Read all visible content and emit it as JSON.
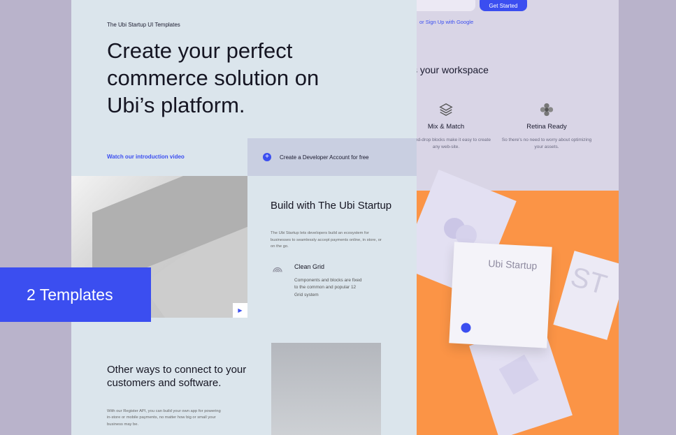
{
  "back_page": {
    "get_started": "Get Started",
    "google_signup": "or Sign Up with Google",
    "workspace_heading": "s your workspace",
    "features": [
      {
        "icon": "layers-icon",
        "title": "Mix & Match",
        "desc": "Drag-and-drop blocks make it easy to create any web-site."
      },
      {
        "icon": "flower-icon",
        "title": "Retina Ready",
        "desc": "So there's no need to worry about optimizing your assets."
      }
    ],
    "card_text": "Ubi Startup",
    "card_mark": "ST"
  },
  "front_page": {
    "eyebrow": "The Ubi Startup UI Templates",
    "hero": "Create your perfect commerce solution on Ubi’s platform.",
    "watch_link": "Watch our introduction video",
    "dev_account": "Create a Developer Account for free",
    "build_title": "Build with The Ubi Startup",
    "build_desc": "The Ubi Startup lets developers build an ecosystem for businesses to seamlessly accept payments online, in store, or on the go.",
    "grid_title": "Clean Grid",
    "grid_desc": "Components and blocks are fixed to the common and popular 12 Grid system",
    "other_title": "Other ways to connect to your customers and software.",
    "other_desc": "With our Register API, you can build your own app for powering in-store or mobile payments, no matter how big or small your business may be."
  },
  "badge": "2 Templates",
  "colors": {
    "accent": "#3b4ef0",
    "orange": "#fb9446",
    "background": "#b9b3cb",
    "front_bg": "#dbe5ec"
  }
}
